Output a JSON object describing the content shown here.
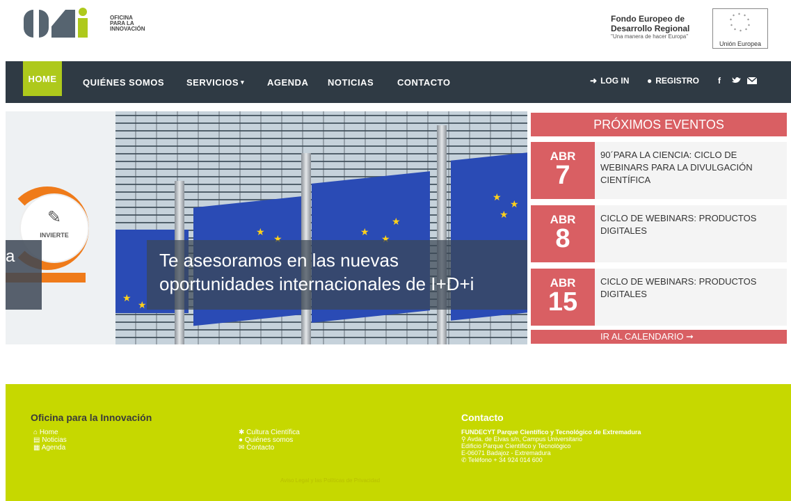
{
  "brand": {
    "logo_line1": "OFICINA",
    "logo_line2": "PARA LA",
    "logo_line3": "INNOVACIÓN"
  },
  "feder": {
    "line1": "Fondo Europeo de",
    "line2": "Desarrollo Regional",
    "tagline": "\"Una manera de hacer Europa\"",
    "eu_label": "Unión Europea"
  },
  "nav": {
    "home": "HOME",
    "about": "QUIÉNES SOMOS",
    "services": "SERVICIOS",
    "agenda": "AGENDA",
    "news": "NOTICIAS",
    "contact": "CONTACTO",
    "login": "LOG IN",
    "register": "REGISTRO"
  },
  "hero": {
    "caption": "Te asesoramos en las nuevas oportunidades internacionales de I+D+i",
    "caption_line1": "Te asesoramos en las nuevas",
    "caption_line2": "oportunidades internacionales de I+D+i",
    "left_fragment": "a",
    "badge": "INVIERTE"
  },
  "events": {
    "header": "PRÓXIMOS EVENTOS",
    "items": [
      {
        "month": "ABR",
        "day": "7",
        "title": "90´PARA LA CIENCIA: CICLO DE WEBINARS PARA LA DIVULGACIÓN CIENTÍFICA"
      },
      {
        "month": "ABR",
        "day": "8",
        "title": "CICLO DE WEBINARS: PRODUCTOS DIGITALES"
      },
      {
        "month": "ABR",
        "day": "15",
        "title": "CICLO DE WEBINARS: PRODUCTOS DIGITALES"
      }
    ],
    "calendar_link": "IR AL CALENDARIO ➞"
  },
  "footer": {
    "title": "Oficina para la Innovación",
    "links_col1": [
      "Home",
      "Noticias",
      "Agenda"
    ],
    "links_col2": [
      "Cultura Científica",
      "Quiénes somos",
      "Contacto"
    ],
    "contact_title": "Contacto",
    "contact_org": "FUNDECYT Parque Científico y Tecnológico de Extremadura",
    "contact_addr1": "Avda. de Elvas s/n, Campus Universitario",
    "contact_addr2": "Edificio Parque Científico y Tecnológico",
    "contact_addr3": "E-06071 Badajoz - Extremadura",
    "contact_phone": "Teléfono + 34 924 014 600",
    "legal": "Aviso Legal y las Políticas de Privacidad"
  },
  "colors": {
    "nav_bg": "#2f3a44",
    "accent_green": "#aec91c",
    "footer_green": "#c6d800",
    "event_red": "#d95f63"
  }
}
